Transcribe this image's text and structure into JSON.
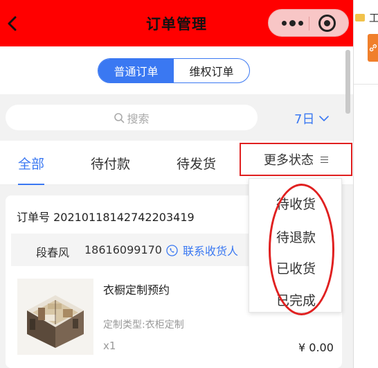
{
  "header": {
    "title": "订单管理",
    "bg_color": "#ff0000"
  },
  "segment": {
    "normal": "普通订单",
    "rights": "维权订单",
    "active": "普通订单",
    "accent": "#3a78f2"
  },
  "search": {
    "placeholder": "搜索",
    "range": "7日"
  },
  "tabs": {
    "all": "全部",
    "unpaid": "待付款",
    "unshipped": "待发货",
    "more": "更多状态",
    "active": "全部"
  },
  "order": {
    "order_no": "订单号 20210118142742203419",
    "receiver_name": "段春风",
    "receiver_phone": "18616099170",
    "contact_label": "联系收货人",
    "product_name": "衣橱定制预约",
    "product_type": "定制类型:衣柜定制",
    "quantity": "x1",
    "price": "¥ 0.00"
  },
  "dropdown": {
    "items": [
      "待收货",
      "待退款",
      "已收货",
      "已完成"
    ]
  },
  "desktop": {
    "label": "工"
  }
}
